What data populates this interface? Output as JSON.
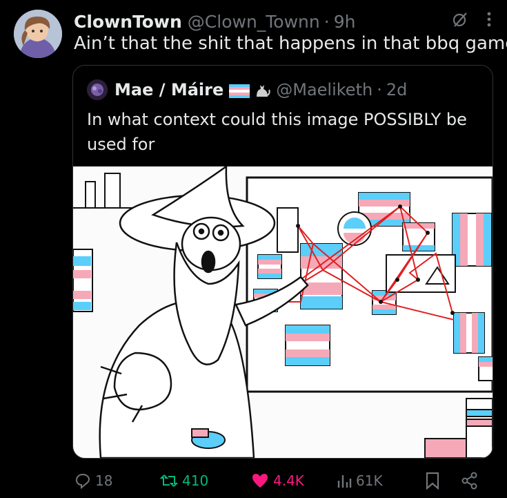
{
  "post": {
    "author_name": "ClownTown",
    "author_handle": "@Clown_Townn",
    "separator": "·",
    "time": "9h",
    "text": "Ain’t that the shit that happens in that bbq game"
  },
  "quoted": {
    "author_name": "Mae / Máire",
    "author_handle": "@Maeliketh",
    "separator": "·",
    "time": "2d",
    "text": "In what context could this image POSSIBLY be used for"
  },
  "actions": {
    "replies": "18",
    "reposts": "410",
    "likes": "4.4K",
    "views": "61K"
  },
  "colors": {
    "background": "#000000",
    "text": "#e7e9ea",
    "muted": "#71767b",
    "repost": "#00ba7c",
    "like": "#f91880",
    "trans_blue": "#5bcefa",
    "trans_pink": "#f5a9b8",
    "string_red": "#e02020"
  },
  "icons": [
    "grok-icon",
    "more-icon",
    "reply-icon",
    "repost-icon",
    "heart-icon",
    "views-icon",
    "bookmark-icon",
    "share-icon"
  ]
}
